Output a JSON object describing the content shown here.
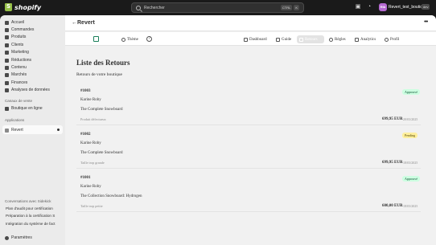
{
  "topbar": {
    "logo_text": "shopify",
    "search_placeholder": "Rechercher",
    "shortcut_ctrl": "CTRL",
    "shortcut_key": "K",
    "store_initials": "Rtb",
    "store_name": "Revert_test_boutique",
    "store_badge": "dev"
  },
  "sidebar": {
    "items": [
      {
        "label": "Accueil",
        "icon": "home-icon"
      },
      {
        "label": "Commandes",
        "icon": "orders-icon"
      },
      {
        "label": "Produits",
        "icon": "tag-icon"
      },
      {
        "label": "Clients",
        "icon": "person-icon"
      },
      {
        "label": "Marketing",
        "icon": "target-icon"
      },
      {
        "label": "Réductions",
        "icon": "discount-icon"
      },
      {
        "label": "Contenu",
        "icon": "content-icon"
      },
      {
        "label": "Marchés",
        "icon": "globe-icon"
      },
      {
        "label": "Finances",
        "icon": "bank-icon"
      },
      {
        "label": "Analyses de données",
        "icon": "chart-icon"
      }
    ],
    "sales_channels_label": "Canaux de vente",
    "online_store_label": "Boutique en ligne",
    "apps_label": "Applications",
    "active_app_label": "Revert",
    "conversations_label": "Conversations avec Sidekick",
    "conversations": [
      "Plan d'audit pour certification",
      "Préparation à la certification S",
      "Intégration du système de fact"
    ],
    "settings_label": "Paramètres"
  },
  "app": {
    "title": "Revert",
    "tabs": [
      {
        "label": "Thème",
        "icon": "theme-icon"
      },
      {
        "label": "Dashboard",
        "icon": "dashboard-icon"
      },
      {
        "label": "Guide",
        "icon": "book-icon"
      },
      {
        "label": "Retours",
        "icon": "return-icon",
        "active": true
      },
      {
        "label": "Règles",
        "icon": "gear-icon"
      },
      {
        "label": "Analytics",
        "icon": "analytics-icon"
      },
      {
        "label": "Profil",
        "icon": "user-icon"
      }
    ],
    "list_title": "Liste des Retours",
    "list_subtitle": "Retours de votre boutique"
  },
  "returns": [
    {
      "number": "#1003",
      "customer": "Karine Roby",
      "product": "The Complete Snowboard",
      "reason": "Produit défectueux",
      "price": "699,95 EUR",
      "date": "20/03/2025",
      "status": "Approuvé",
      "status_color": "#cdfee1",
      "status_text_color": "#0c5132"
    },
    {
      "number": "#1002",
      "customer": "Karine Roby",
      "product": "The Complete Snowboard",
      "reason": "Taille trop grande",
      "price": "699,95 EUR",
      "date": "18/03/2025",
      "status": "Pending",
      "status_color": "#ffef9d",
      "status_text_color": "#4f4700"
    },
    {
      "number": "#1001",
      "customer": "Karine Roby",
      "product": "The Collection Snowboard: Hydrogen",
      "reason": "Taille trop petite",
      "price": "600,00 EUR",
      "date": "18/03/2025",
      "status": "Approuvé",
      "status_color": "#cdfee1",
      "status_text_color": "#0c5132"
    }
  ]
}
